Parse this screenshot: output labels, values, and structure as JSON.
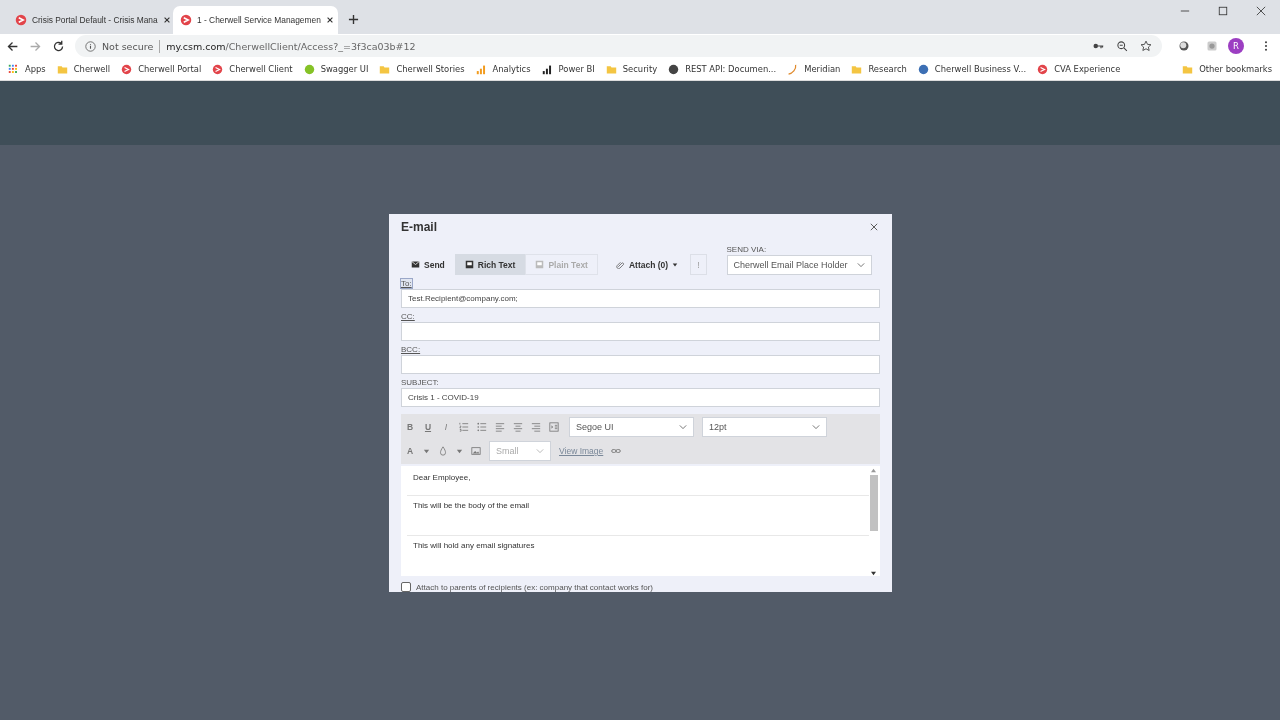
{
  "browser": {
    "tabs": [
      {
        "title": "Crisis Portal Default - Crisis Mana",
        "selected": false
      },
      {
        "title": "1 - Cherwell Service Managemen",
        "selected": true
      }
    ],
    "address": {
      "security": "Not secure",
      "host": "my.csm.com",
      "path": "/CherwellClient/Access?_=3f3ca03b#12"
    },
    "profile_initial": "R",
    "bookmarks": [
      {
        "label": "Apps",
        "kind": "apps"
      },
      {
        "label": "Cherwell",
        "kind": "folder"
      },
      {
        "label": "Cherwell Portal",
        "kind": "site"
      },
      {
        "label": "Cherwell Client",
        "kind": "site"
      },
      {
        "label": "Swagger UI",
        "kind": "swagger"
      },
      {
        "label": "Cherwell Stories",
        "kind": "folder"
      },
      {
        "label": "Analytics",
        "kind": "analytics"
      },
      {
        "label": "Power BI",
        "kind": "powerbi"
      },
      {
        "label": "Security",
        "kind": "folder"
      },
      {
        "label": "REST API: Documen...",
        "kind": "globe"
      },
      {
        "label": "Meridian",
        "kind": "meridian"
      },
      {
        "label": "Research",
        "kind": "folder"
      },
      {
        "label": "Cherwell Business V...",
        "kind": "business"
      },
      {
        "label": "CVA Experience",
        "kind": "site"
      }
    ],
    "other_bookmarks": "Other bookmarks"
  },
  "dialog": {
    "title": "E-mail",
    "toolbar": [
      {
        "label": "Send",
        "kind": "send",
        "selected": false,
        "disabled": false
      },
      {
        "label": "Rich Text",
        "kind": "rich",
        "selected": true,
        "disabled": false
      },
      {
        "label": "Plain Text",
        "kind": "plain",
        "selected": false,
        "disabled": true
      },
      {
        "label": "Attach (0)",
        "kind": "attach",
        "selected": false,
        "disabled": false
      },
      {
        "label": "!",
        "kind": "priority",
        "selected": false,
        "disabled": false
      }
    ],
    "send_via": {
      "label": "SEND VIA:",
      "value": "Cherwell Email Place Holder"
    },
    "fields": [
      {
        "label": "To:",
        "value": "Test.Recipient@company.com;",
        "link": true
      },
      {
        "label": "CC:",
        "link": true
      },
      {
        "label": "BCC:",
        "link": true
      },
      {
        "label": "SUBJECT:",
        "value": "Crisis 1 - COVID-19",
        "link": false
      }
    ],
    "editor": {
      "bold": "B",
      "underline": "U",
      "italic": "I",
      "text_color": "A",
      "font": "Segoe UI",
      "size": "12pt",
      "image_size": "Small",
      "view_image": "View Image",
      "sections": [
        "Dear Employee,",
        "This will be the body of the email",
        "This will hold any email signatures"
      ]
    },
    "attach_parents": {
      "label": "Attach to parents of recipients (ex: company that contact works for)",
      "checked": false
    }
  }
}
